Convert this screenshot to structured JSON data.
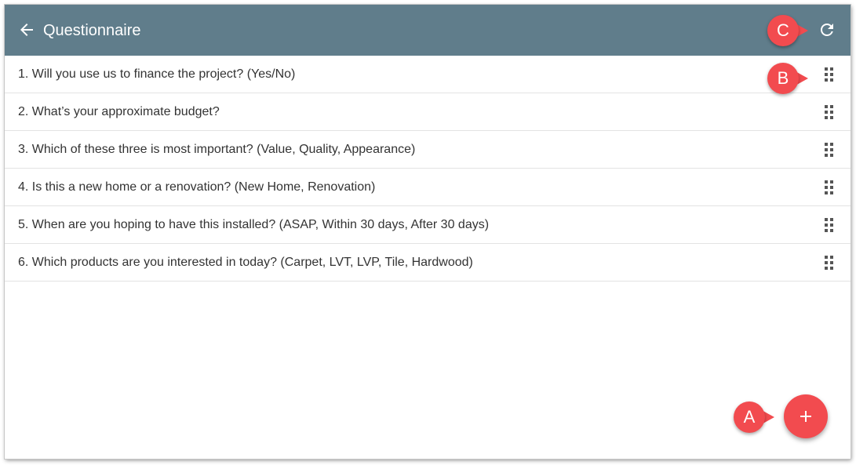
{
  "header": {
    "title": "Questionnaire",
    "back_icon": "arrow-left-icon",
    "refresh_icon": "refresh-icon",
    "background_color": "#607d8b"
  },
  "questions": [
    {
      "label": "1. Will you use us to finance the project? (Yes/No)"
    },
    {
      "label": "2. What’s your approximate budget?"
    },
    {
      "label": "3. Which of these three is most important? (Value, Quality, Appearance)"
    },
    {
      "label": "4. Is this a new home or a renovation? (New Home, Renovation)"
    },
    {
      "label": "5. When are you hoping to have this installed? (ASAP, Within 30 days, After 30 days)"
    },
    {
      "label": "6. Which products are you interested in today? (Carpet, LVT, LVP, Tile, Hardwood)"
    }
  ],
  "row_icon": "drag-handle-icon",
  "fab": {
    "icon": "plus-icon",
    "color": "#f24b4f"
  },
  "callouts": {
    "a": "A",
    "b": "B",
    "c": "C",
    "color": "#f24b4f"
  }
}
